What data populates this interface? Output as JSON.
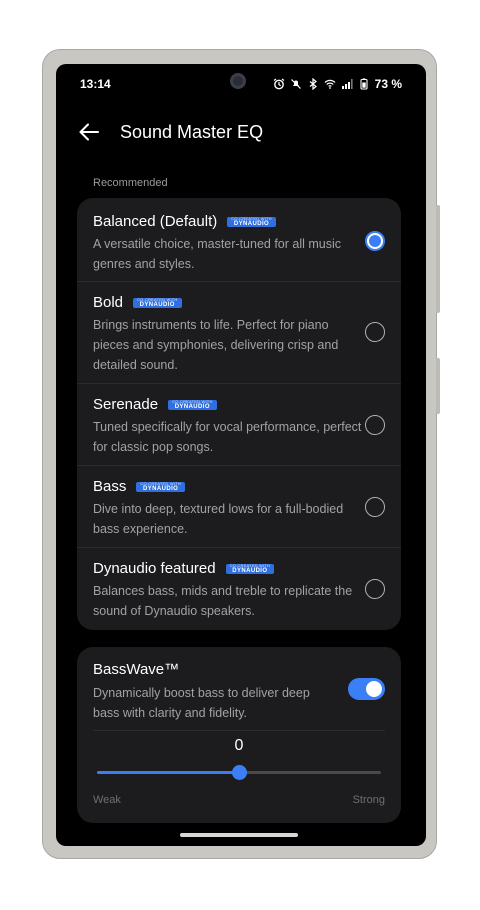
{
  "status": {
    "time": "13:14",
    "battery": "73 %",
    "icons": [
      "alarm-icon",
      "mute-icon",
      "bluetooth-icon",
      "wifi-icon",
      "signal-icon",
      "battery-icon"
    ]
  },
  "header": {
    "title": "Sound Master EQ",
    "back_icon": "arrow-left-icon"
  },
  "recommended": {
    "label": "Recommended",
    "items": [
      {
        "name": "Balanced (Default)",
        "description": "A versatile choice, master-tuned for all music genres and styles.",
        "selected": true
      },
      {
        "name": "Bold",
        "description": "Brings instruments to life. Perfect for piano pieces and symphonies, delivering crisp and detailed sound.",
        "selected": false
      },
      {
        "name": "Serenade",
        "description": "Tuned specifically for vocal performance, perfect for classic pop songs.",
        "selected": false
      },
      {
        "name": "Bass",
        "description": "Dive into deep, textured lows for a full-bodied bass experience.",
        "selected": false
      },
      {
        "name": "Dynaudio featured",
        "description": "Balances bass, mids and treble to replicate the sound of Dynaudio speakers.",
        "selected": false
      }
    ],
    "badge": {
      "line1": "CO-CREATED WITH",
      "line2": "DYNAUDIO"
    }
  },
  "basswave": {
    "title": "BassWave™",
    "description": "Dynamically boost bass to deliver deep bass with clarity and fidelity.",
    "enabled": true,
    "value": "0",
    "level_fraction": 0.5,
    "min_label": "Weak",
    "max_label": "Strong"
  },
  "colors": {
    "accent": "#3b7ff6",
    "card": "#1c1c1e",
    "background": "#000000"
  }
}
